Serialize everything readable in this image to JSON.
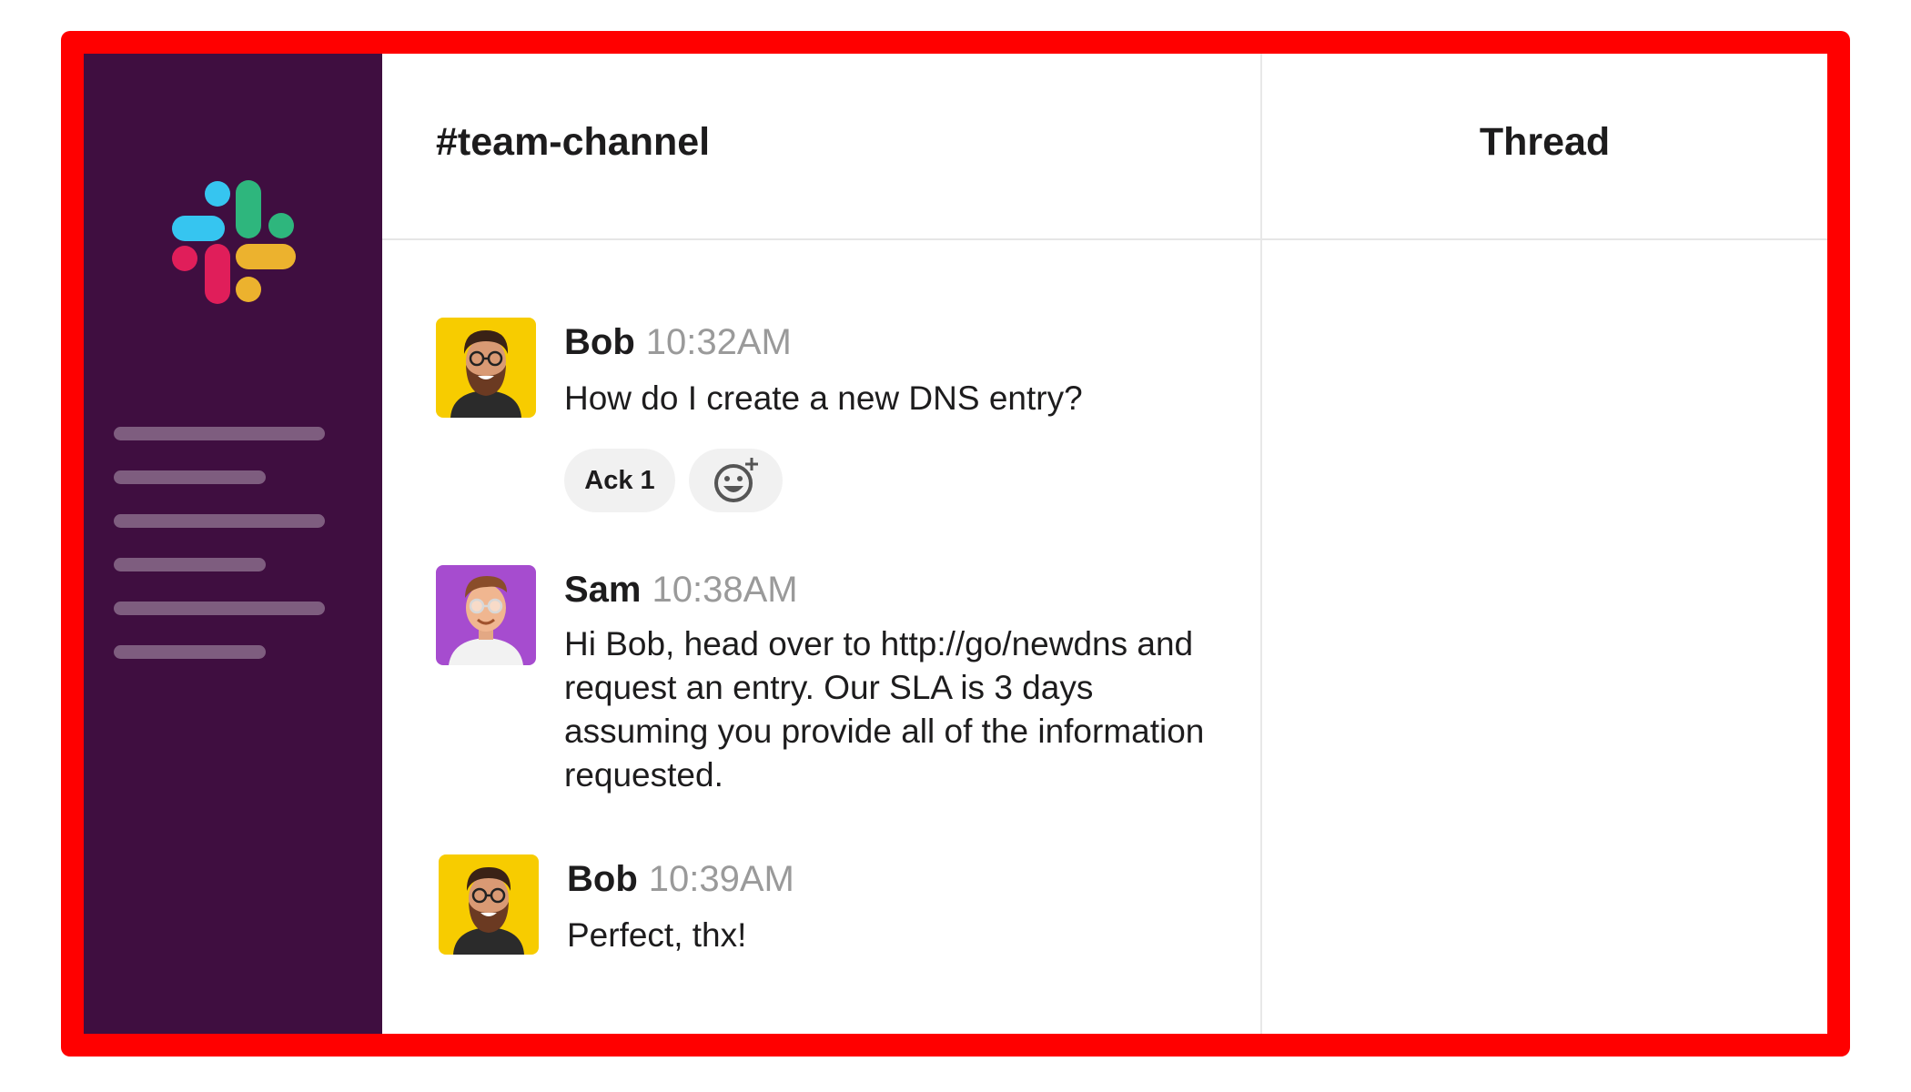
{
  "colors": {
    "frame_border": "#ff0000",
    "sidebar_bg": "#3f0e40",
    "logo_blue": "#36c5f0",
    "logo_green": "#2eb67d",
    "logo_red": "#e01e5a",
    "logo_yellow": "#ecb22e",
    "bob_avatar_bg": "#f7cc00",
    "sam_avatar_bg": "#a64ccf"
  },
  "sidebar": {
    "logo_icon": "slack-logo-icon",
    "line_count": 6
  },
  "channel": {
    "title": "#team-channel"
  },
  "thread": {
    "title": "Thread"
  },
  "messages": [
    {
      "avatar_icon": "bob-avatar-icon",
      "author": "Bob",
      "time": "10:32AM",
      "text": "How do I create a new DNS entry?",
      "reactions": [
        {
          "label": "Ack 1"
        }
      ],
      "add_reaction_icon": "add-reaction-icon"
    },
    {
      "avatar_icon": "sam-avatar-icon",
      "author": "Sam",
      "time": "10:38AM",
      "text": "Hi Bob, head over to http://go/newdns and request an entry. Our SLA is 3 days assuming you provide all of the information requested."
    },
    {
      "avatar_icon": "bob-avatar-icon",
      "author": "Bob",
      "time": "10:39AM",
      "text": "Perfect, thx!"
    }
  ]
}
